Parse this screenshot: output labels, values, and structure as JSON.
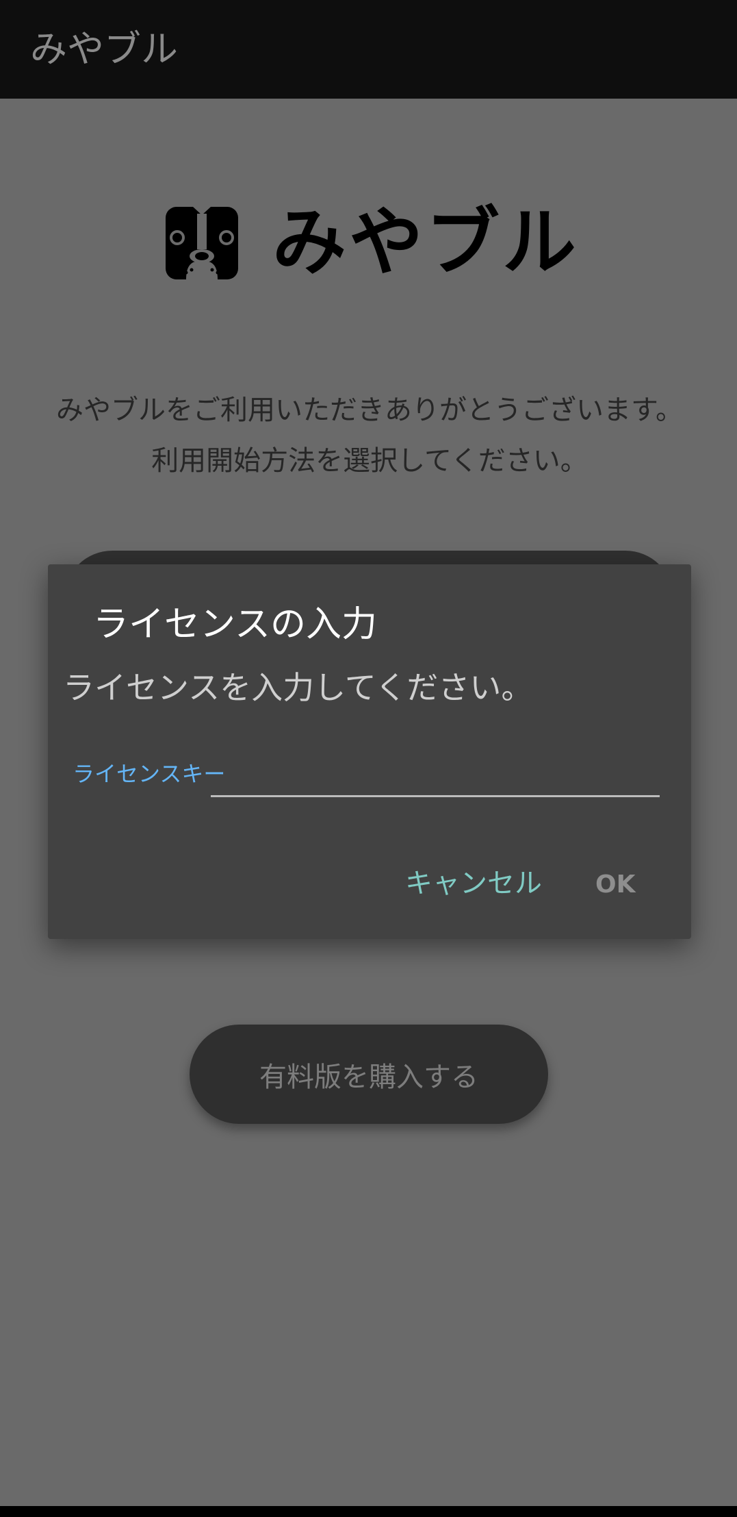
{
  "app_bar": {
    "title": "みやブル"
  },
  "logo": {
    "icon": "bulldog-face-icon",
    "wordmark": "みやブル"
  },
  "intro": {
    "text": "みやブルをご利用いただきありがとうございます。利用開始方法を選択してください。"
  },
  "purchase_button": {
    "label": "有料版を購入する"
  },
  "dialog": {
    "title": "ライセンスの入力",
    "message": "ライセンスを入力してください。",
    "field_label": "ライセンスキー",
    "field_value": "",
    "cancel_label": "キャンセル",
    "ok_label": "OK"
  },
  "colors": {
    "accent_label": "#64b5f6",
    "accent_button": "#80cbc4",
    "dialog_bg": "#424242",
    "scrim_bg": "#6a6a6a"
  }
}
